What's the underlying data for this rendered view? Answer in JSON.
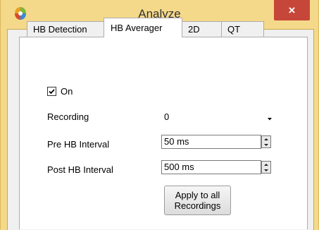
{
  "window": {
    "title": "Analyze",
    "close_glyph": "×",
    "icon": "app-logo-icon"
  },
  "tabs": [
    {
      "label": "HB Detection",
      "active": false
    },
    {
      "label": "HB Averager",
      "active": true
    },
    {
      "label": "2D",
      "active": false
    },
    {
      "label": "QT",
      "active": false
    }
  ],
  "panel": {
    "on_checkbox": {
      "label": "On",
      "checked": true
    },
    "recording": {
      "label": "Recording",
      "value": "0"
    },
    "pre_hb_interval": {
      "label": "Pre HB Interval",
      "value": "50 ms"
    },
    "post_hb_interval": {
      "label": "Post HB Interval",
      "value": "500 ms"
    },
    "apply_button": {
      "line1": "Apply to all",
      "line2": "Recordings"
    }
  },
  "colors": {
    "frame": "#f5d98a",
    "close_button": "#c7463a",
    "panel": "#ffffff"
  }
}
